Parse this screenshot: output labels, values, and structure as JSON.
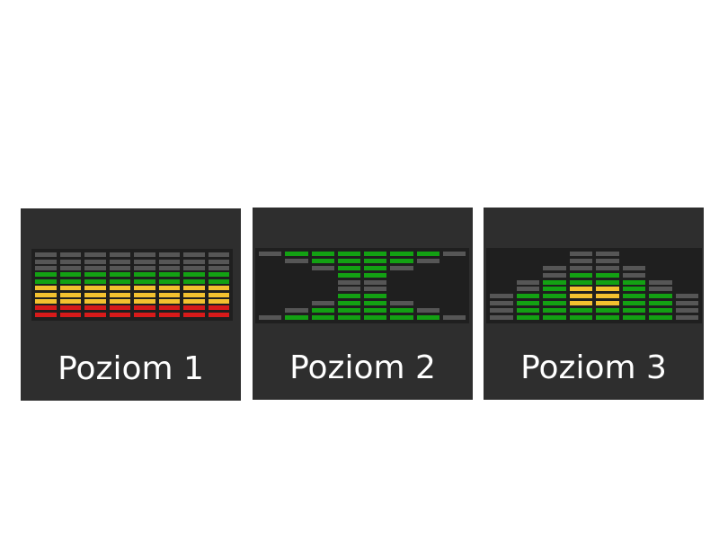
{
  "colors": {
    "card_bg": "#2e2e2e",
    "panel_bg": "#1f1f1f",
    "off": "#565656",
    "green": "#13a113",
    "yellow": "#f3c12f",
    "red": "#d71a1a"
  },
  "levels": [
    {
      "label": "Poziom 1",
      "columns": 8,
      "rows": 10,
      "pattern": "uniform",
      "row_colors": [
        "off",
        "off",
        "off",
        "green",
        "green",
        "yellow",
        "yellow",
        "yellow",
        "red",
        "red"
      ]
    },
    {
      "label": "Poziom 2",
      "columns": 8,
      "rows": 10,
      "pattern": "mirror",
      "column_lit_counts": [
        0,
        1,
        2,
        4,
        4,
        2,
        1,
        0
      ]
    },
    {
      "label": "Poziom 3",
      "columns": 8,
      "rows": 10,
      "pattern": "pyramid",
      "column_heights": [
        4,
        6,
        8,
        10,
        10,
        8,
        6,
        4
      ],
      "column_lit_counts": [
        0,
        4,
        6,
        7,
        7,
        6,
        4,
        0
      ],
      "column_yellow_counts": [
        0,
        0,
        0,
        3,
        3,
        0,
        0,
        0
      ]
    }
  ]
}
